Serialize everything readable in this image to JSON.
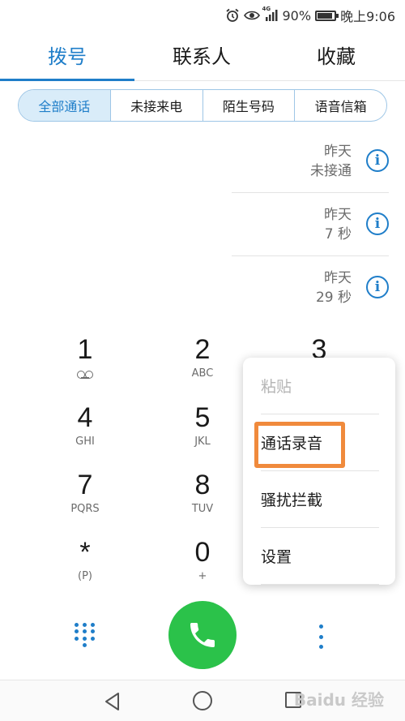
{
  "status_bar": {
    "signal_label": "4G",
    "battery_text": "90%",
    "battery_level": 0.9,
    "time": "晚上9:06",
    "icons": [
      "alarm-icon",
      "eye-icon",
      "signal-icon",
      "battery-icon"
    ]
  },
  "tabs": [
    {
      "label": "拨号",
      "active": true
    },
    {
      "label": "联系人",
      "active": false
    },
    {
      "label": "收藏",
      "active": false
    }
  ],
  "filters": [
    {
      "label": "全部通话",
      "active": true
    },
    {
      "label": "未接来电",
      "active": false
    },
    {
      "label": "陌生号码",
      "active": false
    },
    {
      "label": "语音信箱",
      "active": false
    }
  ],
  "call_log": [
    {
      "date": "昨天",
      "detail": "未接通"
    },
    {
      "date": "昨天",
      "detail": "7 秒"
    },
    {
      "date": "昨天",
      "detail": "29 秒"
    }
  ],
  "keypad": [
    {
      "digit": "1",
      "sub": ""
    },
    {
      "digit": "2",
      "sub": "ABC"
    },
    {
      "digit": "3",
      "sub": ""
    },
    {
      "digit": "4",
      "sub": "GHI"
    },
    {
      "digit": "5",
      "sub": "JKL"
    },
    {
      "digit": "7",
      "sub": "PQRS"
    },
    {
      "digit": "8",
      "sub": "TUV"
    },
    {
      "digit": "*",
      "sub": "(P)"
    },
    {
      "digit": "0",
      "sub": "+"
    }
  ],
  "menu": {
    "items": [
      {
        "label": "粘贴",
        "enabled": false
      },
      {
        "label": "通话录音",
        "enabled": true,
        "highlighted": true
      },
      {
        "label": "骚扰拦截",
        "enabled": true
      },
      {
        "label": "设置",
        "enabled": true
      }
    ]
  },
  "watermark": "Baidu 经验",
  "colors": {
    "accent": "#1f7ec9",
    "call_green": "#2bc24a",
    "highlight_orange": "#f08a3c"
  }
}
